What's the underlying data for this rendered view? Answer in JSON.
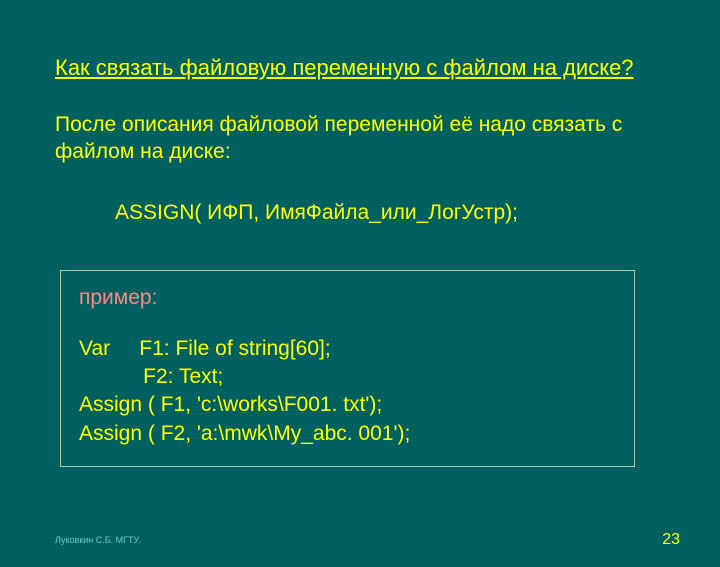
{
  "slide": {
    "title": "Как связать файловую переменную с файлом на диске?",
    "description": "После описания файловой переменной её надо связать с файлом на диске:",
    "syntax": "ASSIGN(  ИФП,   ИмяФайла_или_ЛогУстр);",
    "example": {
      "label": "пример:",
      "code": "Var     F1: File of string[60];\n           F2: Text;\nAssign ( F1, 'c:\\works\\F001. txt');\nAssign ( F2, 'a:\\mwk\\My_abc. 001');"
    },
    "footer": {
      "author": "Луковкин С.Б.  МГТУ.",
      "page": "23"
    }
  }
}
